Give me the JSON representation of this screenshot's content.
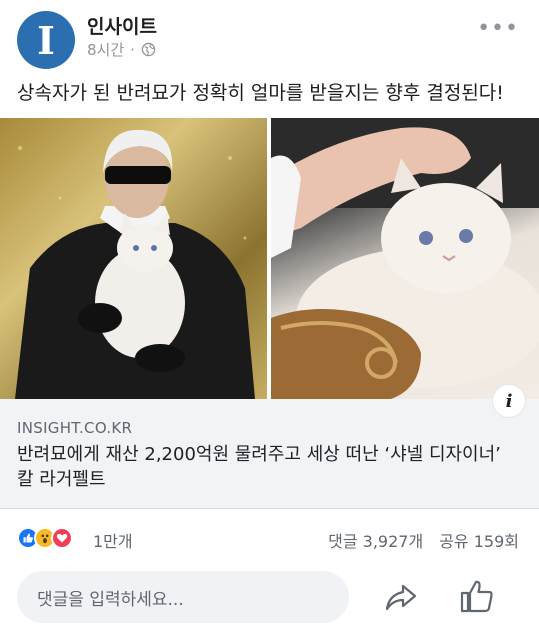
{
  "header": {
    "avatar_letter": "I",
    "page_name": "인사이트",
    "time": "8시간",
    "dot": "·",
    "more": "•••"
  },
  "post": {
    "text": "상속자가 된 반려묘가 정확히 얼마를 받을지는 향후 결정된다!"
  },
  "link": {
    "domain": "INSIGHT.CO.KR",
    "title": "반려묘에게 재산 2,200억원 물려주고 세상 떠난 ‘샤넬 디자이너’ 칼 라거펠트",
    "info_icon": "i"
  },
  "reactions": {
    "count": "1만개",
    "comments": "댓글 3,927개",
    "shares": "공유 159회",
    "icons": [
      "like-icon",
      "wow-icon",
      "love-icon"
    ]
  },
  "footer": {
    "comment_placeholder": "댓글을 입력하세요..."
  },
  "colors": {
    "avatar_bg": "#2b6fb0",
    "like_blue": "#1877f2",
    "wow_yellow": "#f7b928",
    "love_red": "#f33e58",
    "link_box_bg": "#f2f3f5"
  }
}
